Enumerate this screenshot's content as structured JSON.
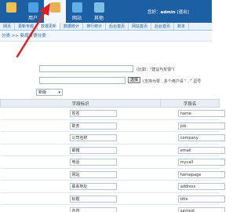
{
  "colors": {
    "header": "#1d5fa3",
    "arrow": "#e02020"
  },
  "topnav": [
    {
      "label": "",
      "icon": "home-icon",
      "color": "#f0c050"
    },
    {
      "label": "用户",
      "icon": "users-icon",
      "color": "#4aa0e0"
    },
    {
      "label": "",
      "icon": "pencil-icon",
      "color": "#e8b050",
      "active": true
    },
    {
      "label": "网站",
      "icon": "globe-icon",
      "color": "#60b0e8"
    },
    {
      "label": "其他",
      "icon": "gear-icon",
      "color": "#7cc0e8"
    }
  ],
  "user": {
    "prefix": "您好：",
    "name": "admin",
    "suffix": "[退出]"
  },
  "subnav": [
    "网页",
    "更新专题",
    "数据更新",
    "数据统计",
    "排行统计",
    "后台首页",
    "网站首页",
    "后台首页",
    "新本"
  ],
  "breadcrumb": "分类 >> 新增反馈分类",
  "form": {
    "line1_hint": "(比如：\"建议与反馈\")",
    "line2_button": "选择",
    "line2_hint": "(支持为零 , 多个用户请 \" , \" 逗号",
    "select_value": "新版"
  },
  "table": {
    "headers": [
      "字段标识",
      "字段名"
    ],
    "rows": [
      {
        "label": "姓名",
        "name": "name"
      },
      {
        "label": "职务",
        "name": "job"
      },
      {
        "label": "公司名称",
        "name": "company"
      },
      {
        "label": "邮箱",
        "name": "email"
      },
      {
        "label": "电话",
        "name": "mycall"
      },
      {
        "label": "网站",
        "name": "homepage"
      },
      {
        "label": "联系地址",
        "name": "address"
      },
      {
        "label": "标题",
        "name": "title"
      },
      {
        "label": "内容",
        "name": "saytext"
      }
    ]
  }
}
